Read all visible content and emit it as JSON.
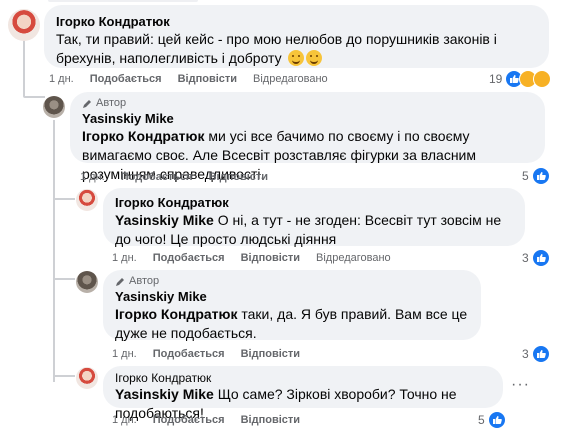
{
  "comments": [
    {
      "author": "Ігорко Кондратюк",
      "text": "Так, ти правий: цей кейс - про мою нелюбов до порушників законів і брехунів, наполегливість і доброту",
      "emojis": [
        "smiling-face-emoji",
        "grinning-face-emoji"
      ],
      "time": "1 дн.",
      "like_label": "Подобається",
      "reply_label": "Відповісти",
      "edited_label": "Відредаговано",
      "reaction_count": "19",
      "reactions": [
        "like",
        "haha",
        "care"
      ]
    },
    {
      "author_tag": "Автор",
      "author": "Yasinskiy Mike",
      "mention": "Ігорко Кондратюк",
      "text": "ми усі все бачимо по своєму і по своєму вимагаємо своє. Але Всесвіт розставляє фігурки за власним розумінням справедливості.",
      "time": "1 дн.",
      "like_label": "Подобається",
      "reply_label": "Відповісти",
      "reaction_count": "5"
    },
    {
      "author": "Ігорко Кондратюк",
      "mention": "Yasinskiy Mike",
      "text": "О ні, а тут - не згоден: Всесвіт тут зовсім не до чого! Це просто людські діяння",
      "time": "1 дн.",
      "like_label": "Подобається",
      "reply_label": "Відповісти",
      "edited_label": "Відредаговано",
      "reaction_count": "3"
    },
    {
      "author_tag": "Автор",
      "author": "Yasinskiy Mike",
      "mention": "Ігорко Кондратюк",
      "text": "таки, да. Я був правий. Вам все це дуже не подобається.",
      "time": "1 дн.",
      "like_label": "Подобається",
      "reply_label": "Відповісти",
      "reaction_count": "3"
    },
    {
      "author": "Ігорко Кондратюк",
      "mention": "Yasinskiy Mike",
      "text": "Що саме? Зіркові хвороби? Точно не подобаються!",
      "time": "1 дн.",
      "like_label": "Подобається",
      "reply_label": "Відповісти",
      "reaction_count": "5"
    }
  ],
  "colors": {
    "bubble": "#f0f2f5",
    "like_blue": "#1877f2",
    "meta_gray": "#65676b",
    "thread_line": "#ced0d4"
  }
}
